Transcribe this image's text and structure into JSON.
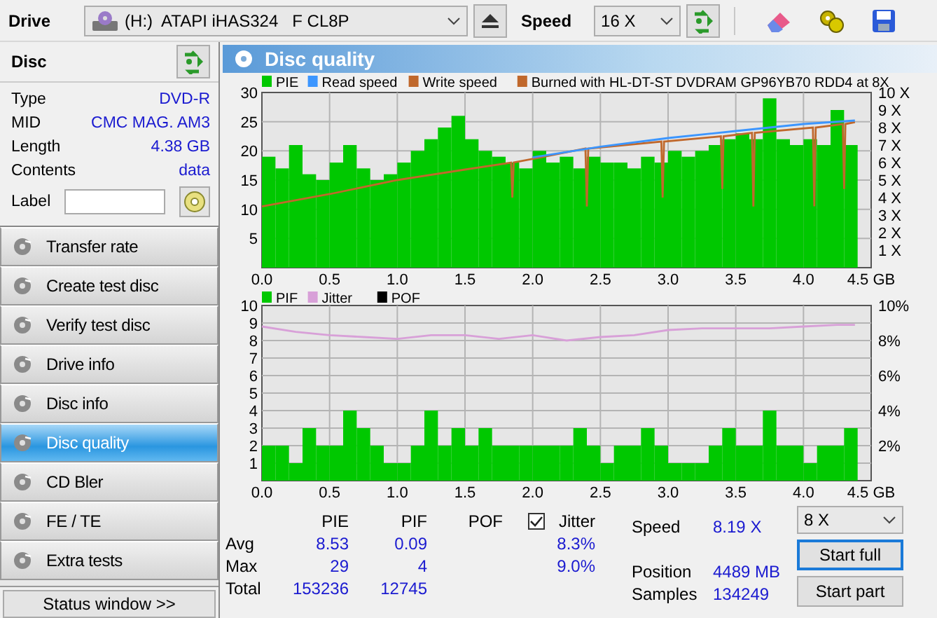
{
  "toolbar": {
    "drive_label": "Drive",
    "drive": {
      "value": "(H:)  ATAPI iHAS324   F CL8P"
    },
    "speed_label": "Speed",
    "speed": {
      "value": "16 X"
    }
  },
  "sidebar": {
    "title": "Disc",
    "info": [
      {
        "label": "Type",
        "value": "DVD-R"
      },
      {
        "label": "MID",
        "value": "CMC MAG. AM3"
      },
      {
        "label": "Length",
        "value": "4.38 GB"
      },
      {
        "label": "Contents",
        "value": "data"
      }
    ],
    "label_field": {
      "label": "Label"
    },
    "nav": [
      {
        "label": "Transfer rate",
        "selected": false
      },
      {
        "label": "Create test disc",
        "selected": false
      },
      {
        "label": "Verify test disc",
        "selected": false
      },
      {
        "label": "Drive info",
        "selected": false
      },
      {
        "label": "Disc info",
        "selected": false
      },
      {
        "label": "Disc quality",
        "selected": true
      },
      {
        "label": "CD Bler",
        "selected": false
      },
      {
        "label": "FE / TE",
        "selected": false
      },
      {
        "label": "Extra tests",
        "selected": false
      }
    ],
    "status_button": "Status window >>"
  },
  "panel": {
    "title": "Disc quality",
    "charts": [
      {
        "legend_note": {
          "label": "Burned with HL-DT-ST DVDRAM GP96YB70 RDD4 at 8X",
          "color": "#c0682c"
        },
        "chart_data": {
          "type": "bar",
          "grid": true,
          "legend": true,
          "xlim": [
            0,
            4.5
          ],
          "ylim": [
            0,
            30
          ],
          "xticks": [
            {
              "value": 0,
              "label": "0.0"
            },
            {
              "value": 0.5,
              "label": "0.5"
            },
            {
              "value": 1,
              "label": "1.0"
            },
            {
              "value": 1.5,
              "label": "1.5"
            },
            {
              "value": 2,
              "label": "2.0"
            },
            {
              "value": 2.5,
              "label": "2.5"
            },
            {
              "value": 3,
              "label": "3.0"
            },
            {
              "value": 3.5,
              "label": "3.5"
            },
            {
              "value": 4,
              "label": "4.0"
            },
            {
              "value": 4.5,
              "label": "4.5 GB"
            }
          ],
          "yticks": [
            5,
            10,
            15,
            20,
            25,
            30
          ],
          "y2ticks": [
            {
              "value": 1,
              "label": "1 X"
            },
            {
              "value": 2,
              "label": "2 X"
            },
            {
              "value": 3,
              "label": "3 X"
            },
            {
              "value": 4,
              "label": "4 X"
            },
            {
              "value": 5,
              "label": "5 X"
            },
            {
              "value": 6,
              "label": "6 X"
            },
            {
              "value": 7,
              "label": "7 X"
            },
            {
              "value": 8,
              "label": "8 X"
            },
            {
              "value": 9,
              "label": "9 X"
            },
            {
              "value": 10,
              "label": "10 X"
            }
          ],
          "y2lim": [
            0,
            10
          ],
          "series": [
            {
              "name": "PIE",
              "color": "#00c800",
              "x": [
                0.05,
                0.15,
                0.25,
                0.35,
                0.45,
                0.55,
                0.65,
                0.75,
                0.85,
                0.95,
                1.05,
                1.15,
                1.25,
                1.35,
                1.45,
                1.55,
                1.65,
                1.75,
                1.85,
                1.95,
                2.05,
                2.15,
                2.25,
                2.35,
                2.45,
                2.55,
                2.65,
                2.75,
                2.85,
                2.95,
                3.05,
                3.15,
                3.25,
                3.35,
                3.45,
                3.55,
                3.65,
                3.75,
                3.85,
                3.95,
                4.05,
                4.15,
                4.25,
                4.35
              ],
              "values": [
                19,
                17,
                21,
                16,
                15,
                18,
                21,
                17,
                15,
                16,
                18,
                20,
                22,
                24,
                26,
                22,
                20,
                19,
                18,
                17,
                20,
                18,
                19,
                17,
                19,
                18,
                18,
                17,
                19,
                18,
                20,
                19,
                20,
                21,
                22,
                23,
                22,
                29,
                22,
                21,
                22,
                21,
                27,
                21
              ]
            },
            {
              "name": "Read speed",
              "color": "#3c96ff",
              "type": "line",
              "axis": "y2",
              "x": [
                2,
                2.5,
                3,
                3.5,
                4,
                4.38
              ],
              "values": [
                6.3,
                6.9,
                7.4,
                7.8,
                8.2,
                8.4
              ]
            },
            {
              "name": "Write speed",
              "color": "#c0682c",
              "type": "line",
              "axis": "y2",
              "x": [
                0,
                0.5,
                1,
                1.5,
                1.84,
                1.85,
                1.86,
                2.39,
                2.4,
                2.41,
                2.95,
                2.96,
                2.97,
                3.39,
                3.4,
                3.41,
                3.62,
                3.63,
                3.64,
                4.07,
                4.08,
                4.09,
                4.29,
                4.3,
                4.31,
                4.38
              ],
              "values": [
                3.5,
                4.2,
                5.0,
                5.6,
                6.0,
                4.0,
                6.0,
                6.8,
                3.5,
                6.8,
                7.2,
                4.0,
                7.2,
                7.5,
                4.5,
                7.5,
                7.7,
                3.5,
                7.7,
                8.0,
                3.5,
                8.0,
                8.2,
                4.5,
                8.2,
                8.3
              ]
            }
          ]
        }
      },
      {
        "chart_data": {
          "type": "bar",
          "grid": true,
          "legend": true,
          "xlim": [
            0,
            4.5
          ],
          "ylim": [
            0,
            10
          ],
          "xticks": [
            {
              "value": 0,
              "label": "0.0"
            },
            {
              "value": 0.5,
              "label": "0.5"
            },
            {
              "value": 1,
              "label": "1.0"
            },
            {
              "value": 1.5,
              "label": "1.5"
            },
            {
              "value": 2,
              "label": "2.0"
            },
            {
              "value": 2.5,
              "label": "2.5"
            },
            {
              "value": 3,
              "label": "3.0"
            },
            {
              "value": 3.5,
              "label": "3.5"
            },
            {
              "value": 4,
              "label": "4.0"
            },
            {
              "value": 4.5,
              "label": "4.5 GB"
            }
          ],
          "yticks": [
            1,
            2,
            3,
            4,
            5,
            6,
            7,
            8,
            9,
            10
          ],
          "y2ticks": [
            {
              "value": 2,
              "label": "2%"
            },
            {
              "value": 4,
              "label": "4%"
            },
            {
              "value": 6,
              "label": "6%"
            },
            {
              "value": 8,
              "label": "8%"
            },
            {
              "value": 10,
              "label": "10%"
            }
          ],
          "y2lim": [
            0,
            10
          ],
          "series": [
            {
              "name": "PIF",
              "color": "#00c800",
              "x": [
                0.05,
                0.15,
                0.25,
                0.35,
                0.45,
                0.55,
                0.65,
                0.75,
                0.85,
                0.95,
                1.05,
                1.15,
                1.25,
                1.35,
                1.45,
                1.55,
                1.65,
                1.75,
                1.85,
                1.95,
                2.05,
                2.15,
                2.25,
                2.35,
                2.45,
                2.55,
                2.65,
                2.75,
                2.85,
                2.95,
                3.05,
                3.15,
                3.25,
                3.35,
                3.45,
                3.55,
                3.65,
                3.75,
                3.85,
                3.95,
                4.05,
                4.15,
                4.25,
                4.35
              ],
              "values": [
                2,
                2,
                1,
                3,
                2,
                2,
                4,
                3,
                2,
                1,
                1,
                2,
                4,
                2,
                3,
                2,
                3,
                2,
                2,
                2,
                2,
                2,
                2,
                3,
                2,
                1,
                2,
                2,
                3,
                2,
                1,
                1,
                1,
                2,
                3,
                2,
                2,
                4,
                2,
                2,
                1,
                2,
                2,
                3
              ]
            },
            {
              "name": "Jitter",
              "color": "#d8a0d8",
              "type": "line",
              "x": [
                0,
                0.25,
                0.5,
                0.75,
                1,
                1.25,
                1.5,
                1.75,
                2,
                2.25,
                2.5,
                2.75,
                3,
                3.25,
                3.5,
                3.75,
                4,
                4.25,
                4.38
              ],
              "values": [
                8.8,
                8.5,
                8.3,
                8.2,
                8.1,
                8.3,
                8.3,
                8.1,
                8.3,
                8.0,
                8.2,
                8.3,
                8.6,
                8.7,
                8.7,
                8.7,
                8.8,
                8.9,
                8.9
              ]
            },
            {
              "name": "POF",
              "color": "#000000"
            }
          ]
        }
      }
    ],
    "stats": {
      "columns": [
        "PIE",
        "PIF",
        "POF"
      ],
      "jitter": {
        "label": "Jitter",
        "checked": true
      },
      "rows": [
        {
          "label": "Avg",
          "pie": "8.53",
          "pif": "0.09",
          "jitter": "8.3%"
        },
        {
          "label": "Max",
          "pie": "29",
          "pif": "4",
          "jitter": "9.0%"
        },
        {
          "label": "Total",
          "pie": "153236",
          "pif": "12745"
        }
      ]
    },
    "readings": [
      {
        "label": "Speed",
        "value": "8.19 X"
      },
      {
        "label": "Position",
        "value": "4489 MB"
      },
      {
        "label": "Samples",
        "value": "134249"
      }
    ],
    "speed_select": {
      "value": "8 X"
    },
    "buttons": [
      {
        "label": "Start full",
        "focused": true
      },
      {
        "label": "Start part",
        "focused": false
      }
    ]
  }
}
